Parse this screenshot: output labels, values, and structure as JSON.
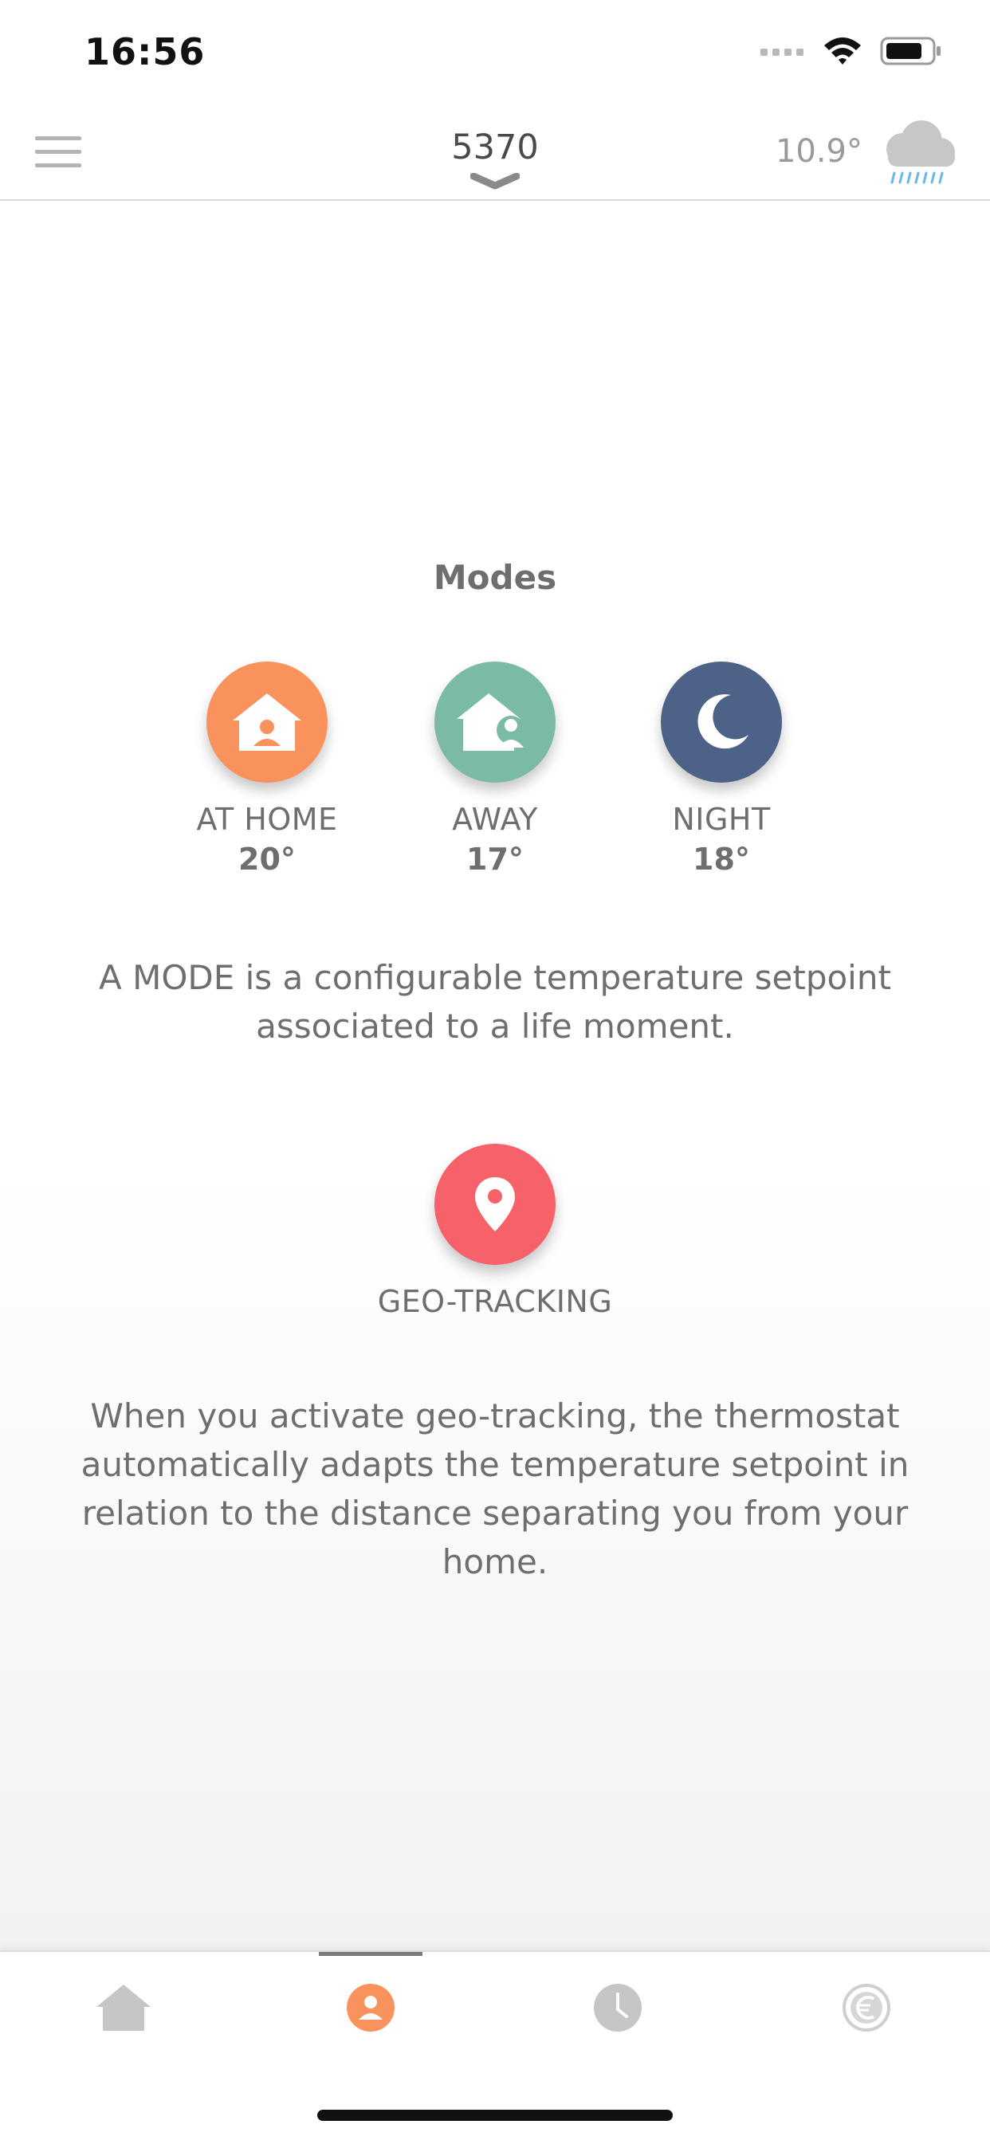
{
  "status": {
    "time": "16:56"
  },
  "header": {
    "device": "5370",
    "weather_temp": "10.9°",
    "weather_icon": "cloud-rain-icon"
  },
  "modes": {
    "title": "Modes",
    "items": [
      {
        "label": "AT HOME",
        "temp": "20°",
        "color": "#f9925d",
        "icon": "home-person-icon"
      },
      {
        "label": "AWAY",
        "temp": "17°",
        "color": "#7bbba5",
        "icon": "home-away-icon"
      },
      {
        "label": "NIGHT",
        "temp": "18°",
        "color": "#4c6387",
        "icon": "moon-icon"
      }
    ],
    "description": "A MODE is a configurable temperature setpoint associated to a life moment."
  },
  "geo": {
    "label": "GEO-TRACKING",
    "color": "#f6616a",
    "icon": "location-pin-icon",
    "description": "When you activate geo-tracking, the thermostat automatically adapts the temperature setpoint in relation to the distance separating you from your home."
  },
  "tabs": [
    {
      "name": "home",
      "icon": "house-icon",
      "active": false
    },
    {
      "name": "modes",
      "icon": "person-icon",
      "active": true
    },
    {
      "name": "schedule",
      "icon": "clock-icon",
      "active": false
    },
    {
      "name": "savings",
      "icon": "euro-icon",
      "active": false
    }
  ]
}
